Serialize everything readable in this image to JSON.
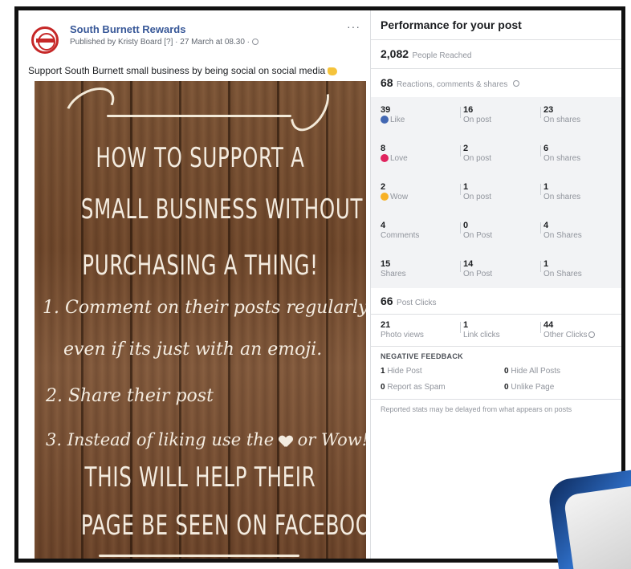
{
  "post": {
    "page_name": "South Burnett Rewards",
    "meta": "Published by Kristy Board [?] · 27 March at 08.30 · ",
    "more": "···",
    "caption": "Support South Burnett small business by being social on social media",
    "image_text": {
      "line1": "HOW TO SUPPORT A",
      "line2": "SMALL BUSINESS WITHOUT",
      "line3": "PURCHASING A THING!",
      "line4": "1. Comment on their posts regularly",
      "line5": "even if its just with an emoji.",
      "line6": "2. Share their post",
      "line7a": "3. Instead of liking use the",
      "line7b": "or Wow!",
      "line8": "THIS WILL HELP THEIR",
      "line9": "PAGE BE SEEN ON FACEBOOK."
    }
  },
  "stats": {
    "title": "Performance for your post",
    "reached_value": "2,082",
    "reached_label": "People Reached",
    "reactions_value": "68",
    "reactions_label": "Reactions, comments & shares",
    "rows": [
      {
        "total": "39",
        "label": "Like",
        "on_post": "16",
        "on_post_label": "On post",
        "on_shares": "23",
        "on_shares_label": "On shares"
      },
      {
        "total": "8",
        "label": "Love",
        "on_post": "2",
        "on_post_label": "On post",
        "on_shares": "6",
        "on_shares_label": "On shares"
      },
      {
        "total": "2",
        "label": "Wow",
        "on_post": "1",
        "on_post_label": "On post",
        "on_shares": "1",
        "on_shares_label": "On shares"
      },
      {
        "total": "4",
        "label": "Comments",
        "on_post": "0",
        "on_post_label": "On Post",
        "on_shares": "4",
        "on_shares_label": "On Shares"
      },
      {
        "total": "15",
        "label": "Shares",
        "on_post": "14",
        "on_post_label": "On Post",
        "on_shares": "1",
        "on_shares_label": "On Shares"
      }
    ],
    "clicks_value": "66",
    "clicks_label": "Post Clicks",
    "photo_views": "21",
    "photo_views_label": "Photo views",
    "link_clicks": "1",
    "link_clicks_label": "Link clicks",
    "other_clicks": "44",
    "other_clicks_label": "Other Clicks",
    "negative_title": "NEGATIVE FEEDBACK",
    "hide_post": "1",
    "hide_post_label": "Hide Post",
    "hide_all": "0",
    "hide_all_label": "Hide All Posts",
    "spam": "0",
    "spam_label": "Report as Spam",
    "unlike": "0",
    "unlike_label": "Unlike Page",
    "footnote": "Reported stats may be delayed from what appears on posts"
  }
}
